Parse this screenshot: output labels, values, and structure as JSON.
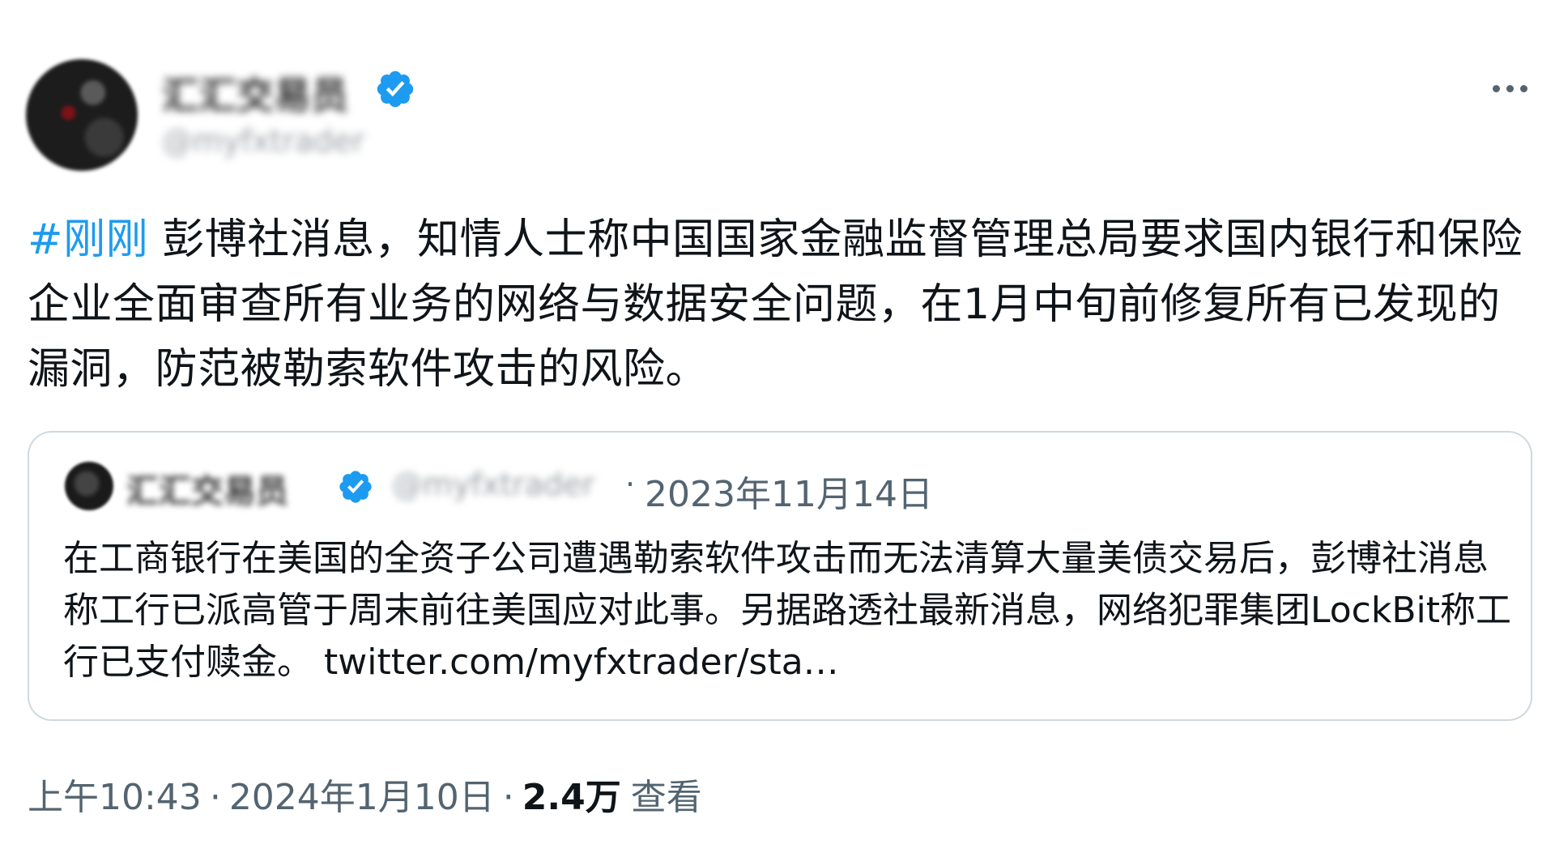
{
  "author": {
    "display_name": "汇汇交易员",
    "handle": "@myfxtrader"
  },
  "tweet": {
    "hashtag": "#刚刚",
    "text": " 彭博社消息，知情人士称中国国家金融监督管理总局要求国内银行和保险企业全面审查所有业务的网络与数据安全问题，在1月中旬前修复所有已发现的漏洞，防范被勒索软件攻击的风险。"
  },
  "quote": {
    "display_name": "汇汇交易员",
    "handle": "@myfxtrader",
    "separator": "·",
    "date": "2023年11月14日",
    "text": "在工商银行在美国的全资子公司遭遇勒索软件攻击而无法清算大量美债交易后，彭博社消息称工行已派高管于周末前往美国应对此事。另据路透社最新消息，网络犯罪集团LockBit称工行已支付赎金。",
    "link": "twitter.com/myfxtrader/sta…"
  },
  "footer": {
    "time": "上午10:43",
    "separator": "·",
    "date": "2024年1月10日",
    "views_count": "2.4万",
    "views_label": "查看"
  },
  "icons": {
    "verified": "verified-badge-icon",
    "more": "more-options-icon"
  },
  "colors": {
    "accent": "#1d9bf0",
    "secondary_text": "#536471",
    "primary_text": "#0f1419",
    "border": "#cfd9de"
  }
}
